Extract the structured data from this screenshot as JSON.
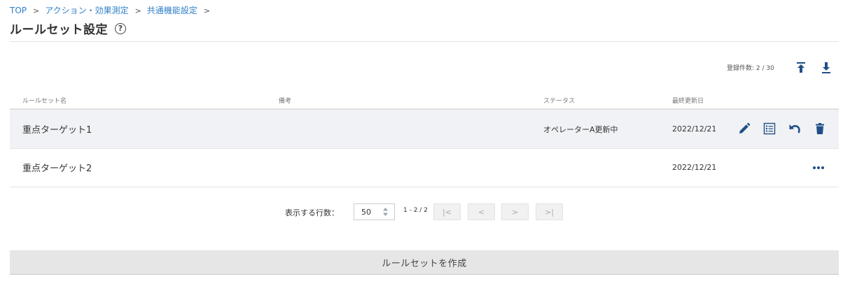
{
  "breadcrumb": {
    "items": [
      "TOP",
      "アクション・効果測定",
      "共通機能設定"
    ],
    "separator": ">"
  },
  "page": {
    "title": "ルールセット設定",
    "help_icon": "?"
  },
  "toolbar": {
    "count_text": "登録件数: 2 / 30",
    "upload_icon": "upload-icon",
    "download_icon": "download-icon"
  },
  "table": {
    "headers": [
      "ルールセット名",
      "備考",
      "ステータス",
      "最終更新日"
    ],
    "rows": [
      {
        "name": "重点ターゲット1",
        "note": "",
        "status": "オペレーターA更新中",
        "date": "2022/12/21",
        "actions": [
          "edit-icon",
          "checklist-icon",
          "undo-icon",
          "trash-icon"
        ]
      },
      {
        "name": "重点ターゲット2",
        "note": "",
        "status": "",
        "date": "2022/12/21",
        "actions": [
          "more-icon"
        ]
      }
    ]
  },
  "pagination": {
    "rows_label": "表示する行数：",
    "rows_per_page": "50",
    "range_text": "1 - 2 / 2",
    "first_label": "|<",
    "prev_label": "<",
    "next_label": ">",
    "last_label": ">|"
  },
  "create_button": {
    "label": "ルールセットを作成"
  },
  "colors": {
    "link": "#2f7fc8",
    "icon": "#1f4f86",
    "row_highlight": "#f1f2f5"
  }
}
